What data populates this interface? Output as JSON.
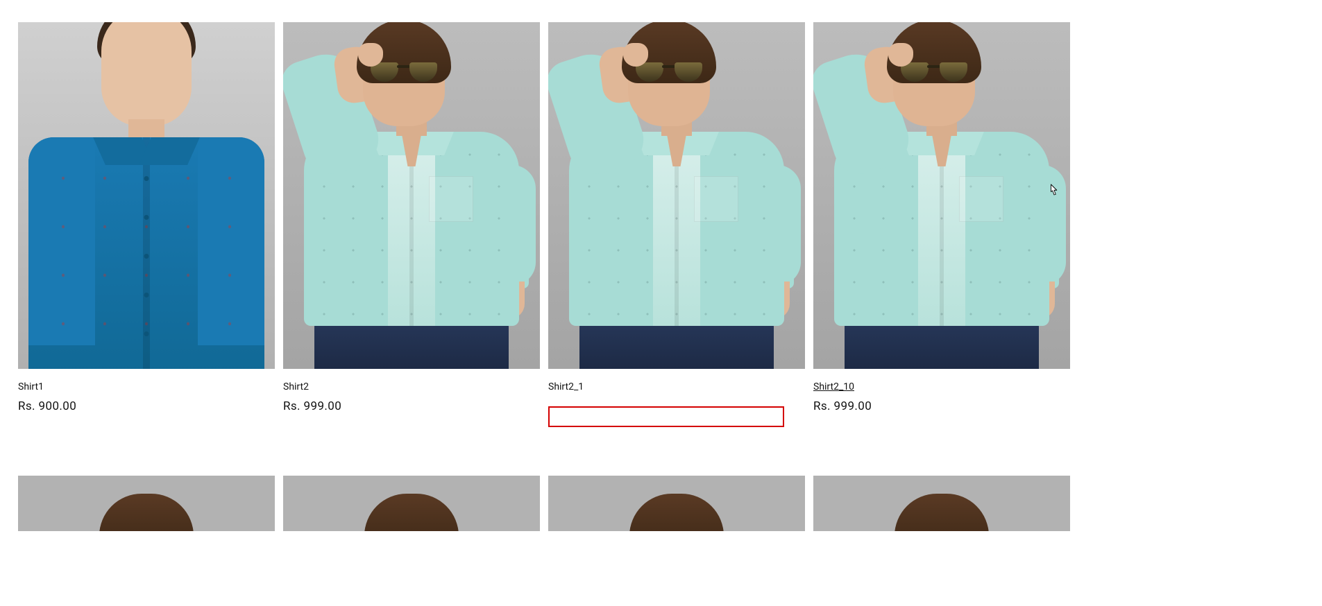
{
  "currency_prefix": "Rs. ",
  "products": [
    {
      "name": "Shirt1",
      "price": "Rs. 900.00"
    },
    {
      "name": "Shirt2",
      "price": "Rs. 999.00"
    },
    {
      "name": "Shirt2_1",
      "price": ""
    },
    {
      "name": "Shirt2_10",
      "price": "Rs. 999.00"
    }
  ],
  "highlighted_product_index": 2,
  "hovered_product_index": 3
}
